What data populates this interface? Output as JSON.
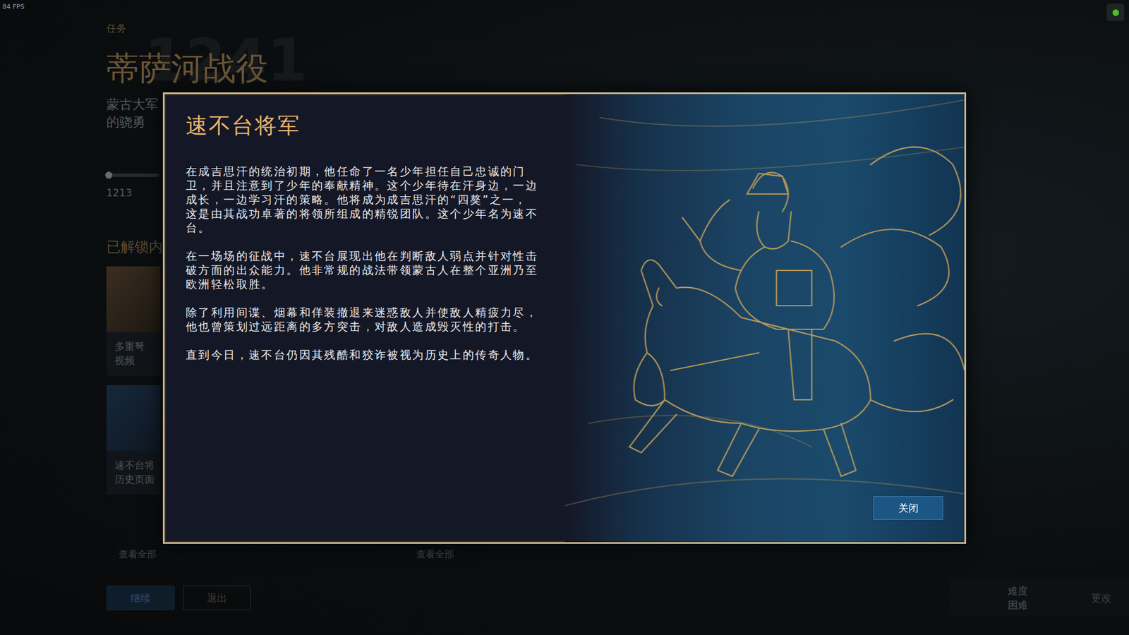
{
  "hud": {
    "fps": "84 FPS",
    "status_on": true
  },
  "mission": {
    "label": "任务",
    "year": "1241",
    "title": "蒂萨河战役",
    "description_lines": [
      "蒙古大军",
      "的骁勇"
    ],
    "timeline": {
      "label": "1213",
      "level": 0.0
    },
    "unlocked_heading": "已解锁内",
    "cards": [
      {
        "title": "多重弩",
        "subtitle": "视频",
        "kind": "video"
      },
      {
        "title": "速不台将",
        "subtitle": "历史页面",
        "kind": "history"
      }
    ],
    "view_all": [
      "查看全部",
      "查看全部"
    ],
    "buttons": [
      {
        "label": "继续",
        "kind": "primary"
      },
      {
        "label": "退出",
        "kind": "secondary"
      }
    ],
    "difficulty": {
      "label": "难度",
      "value": "困难",
      "action": "更改"
    }
  },
  "modal": {
    "title": "速不台将军",
    "paragraphs": [
      "在成吉思汗的统治初期，他任命了一名少年担任自己忠诚的门卫，并且注意到了少年的奉献精神。这个少年待在汗身边，一边成长，一边学习汗的策略。他将成为成吉思汗的“四獒”之一，这是由其战功卓著的将领所组成的精锐团队。这个少年名为速不台。",
      "在一场场的征战中，速不台展现出他在判断敌人弱点并针对性击破方面的出众能力。他非常规的战法带领蒙古人在整个亚洲乃至欧洲轻松取胜。",
      "除了利用间谍、烟幕和佯装撤退来迷惑敌人并使敌人精疲力尽，他也曾策划过远距离的多方突击，对敌人造成毁灭性的打击。",
      "直到今日，速不台仍因其残酷和狡诈被视为历史上的传奇人物。"
    ],
    "close": "关闭"
  }
}
